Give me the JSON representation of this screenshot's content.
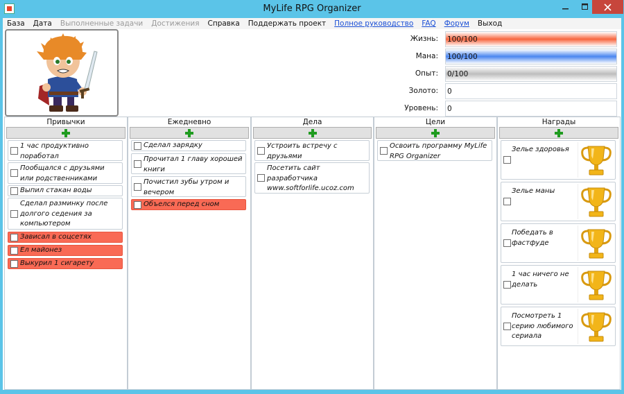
{
  "window": {
    "title": "MyLife RPG Organizer"
  },
  "menu": [
    {
      "label": "База",
      "state": "normal"
    },
    {
      "label": "Дата",
      "state": "normal"
    },
    {
      "label": "Выполненные задачи",
      "state": "disabled"
    },
    {
      "label": "Достижения",
      "state": "disabled"
    },
    {
      "label": "Справка",
      "state": "normal"
    },
    {
      "label": "Поддержать проект",
      "state": "normal"
    },
    {
      "label": "Полное руководство",
      "state": "link"
    },
    {
      "label": "FAQ",
      "state": "link"
    },
    {
      "label": "Форум",
      "state": "link"
    },
    {
      "label": "Выход",
      "state": "normal"
    }
  ],
  "stats": {
    "life": {
      "label": "Жизнь:",
      "value": "100/100",
      "fill": 1.0,
      "color": "#f8663f"
    },
    "mana": {
      "label": "Мана:",
      "value": "100/100",
      "fill": 1.0,
      "color": "#4a86f0"
    },
    "exp": {
      "label": "Опыт:",
      "value": "0/100",
      "fill": 1.0,
      "color": "#bdbdbd"
    },
    "gold": {
      "label": "Золото:",
      "value": "0"
    },
    "level": {
      "label": "Уровень:",
      "value": "0"
    }
  },
  "columns": {
    "habits": {
      "header": "Привычки",
      "items": [
        {
          "text": "1 час продуктивно поработал",
          "bad": false
        },
        {
          "text": "Пообщался с друзьями или родственниками",
          "bad": false
        },
        {
          "text": "Выпил стакан воды",
          "bad": false
        },
        {
          "text": "Сделал разминку после долгого седения за компьютером",
          "bad": false
        },
        {
          "text": "Зависал в соцсетях",
          "bad": true
        },
        {
          "text": "Ел майонез",
          "bad": true
        },
        {
          "text": "Выкурил 1 сигарету",
          "bad": true
        }
      ]
    },
    "daily": {
      "header": "Ежедневно",
      "items": [
        {
          "text": "Сделал зарядку",
          "bad": false
        },
        {
          "text": "Прочитал 1 главу хорошей книги",
          "bad": false
        },
        {
          "text": "Почистил зубы утром и вечером",
          "bad": false
        },
        {
          "text": "Объелся перед сном",
          "bad": true
        }
      ]
    },
    "todos": {
      "header": "Дела",
      "items": [
        {
          "text": "Устроить встречу с друзьями",
          "bad": false
        },
        {
          "text": "Посетить сайт разработчика www.softforlife.ucoz.com",
          "bad": false
        }
      ]
    },
    "goals": {
      "header": "Цели",
      "items": [
        {
          "text": "Освоить программу MyLife RPG Organizer",
          "bad": false
        }
      ]
    },
    "rewards": {
      "header": "Награды",
      "items": [
        {
          "text": "Зелье здоровья"
        },
        {
          "text": "Зелье маны"
        },
        {
          "text": "Победать в фастфуде"
        },
        {
          "text": "1 час ничего не делать"
        },
        {
          "text": "Посмотреть 1 серию любимого сериала"
        }
      ]
    }
  },
  "colors": {
    "titlebar": "#5bc4e8",
    "close": "#c7463c",
    "bad_task": "#f96a55",
    "add_plus": "#1f9b1f"
  }
}
